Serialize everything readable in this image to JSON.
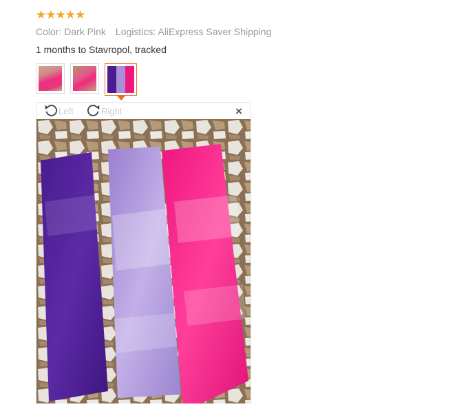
{
  "review": {
    "rating": 5,
    "stars": [
      "★",
      "★",
      "★",
      "★",
      "★"
    ],
    "color_text": "Color: Dark Pink",
    "logistics_text": "Logistics: AliExpress Saver Shipping",
    "delivery_text": "1 months to Stavropol, tracked"
  },
  "thumbnails": [
    {
      "name": "pink-bag-photo-1",
      "active": false
    },
    {
      "name": "pink-bag-photo-2",
      "active": false
    },
    {
      "name": "three-bags-photo",
      "active": true
    }
  ],
  "viewer": {
    "rotate_left_label": "Left",
    "rotate_right_label": "Right",
    "close_label": "×"
  },
  "colors": {
    "star": "#f5a623",
    "active_border": "#e96d1f",
    "purple": "#4a1c8f",
    "lavender": "#a98fd6",
    "pink": "#f0167f"
  }
}
